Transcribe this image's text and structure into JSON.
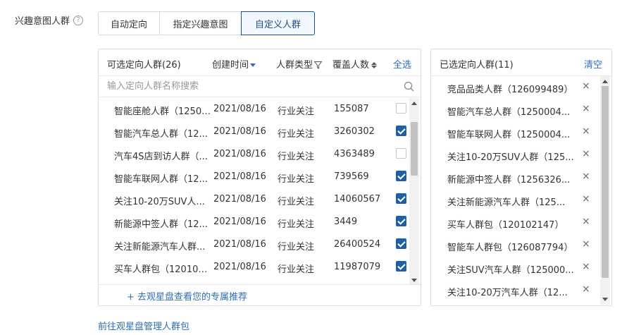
{
  "field": {
    "label": "兴趣意图人群",
    "help_icon": "?"
  },
  "tabs": [
    {
      "label": "自动定向",
      "active": false
    },
    {
      "label": "指定兴趣意图",
      "active": false
    },
    {
      "label": "自定义人群",
      "active": true
    }
  ],
  "left": {
    "title": "可选定向人群(26)",
    "col_created": "创建时间",
    "col_type": "人群类型",
    "col_coverage": "覆盖人数",
    "select_all": "全选",
    "search_placeholder": "输入定向人群名称搜索",
    "rows": [
      {
        "name": "智能座舱人群（12508...",
        "date": "2021/08/16",
        "type": "行业关注",
        "count": "155087",
        "checked": false
      },
      {
        "name": "智能汽车总人群（12...",
        "date": "2021/08/16",
        "type": "行业关注",
        "count": "3260302",
        "checked": true
      },
      {
        "name": "汽车4S店到访人群（...",
        "date": "2021/08/16",
        "type": "行业关注",
        "count": "4363489",
        "checked": false
      },
      {
        "name": "智能车联网人群（12...",
        "date": "2021/08/16",
        "type": "行业关注",
        "count": "739569",
        "checked": true
      },
      {
        "name": "关注10-20万SUV人...",
        "date": "2021/08/16",
        "type": "行业关注",
        "count": "14060567",
        "checked": true
      },
      {
        "name": "新能源中签人群（12...",
        "date": "2021/08/16",
        "type": "行业关注",
        "count": "3449",
        "checked": true
      },
      {
        "name": "关注新能源汽车人群...",
        "date": "2021/08/16",
        "type": "行业关注",
        "count": "26400524",
        "checked": true
      },
      {
        "name": "买车人群包（120102...",
        "date": "2021/08/16",
        "type": "行业关注",
        "count": "11987079",
        "checked": true
      }
    ],
    "footer_link": "+ 去观星盘查看您的专属推荐"
  },
  "right": {
    "title": "已选定向人群(11)",
    "clear": "清空",
    "items": [
      "竞品品类人群（126099489）",
      "智能汽车总人群（1250004...",
      "智能车联网人群（1250004...",
      "关注10-20万SUV人群（125...",
      "新能源中签人群（1256326...",
      "关注新能源汽车人群（125...",
      "买车人群包（120102147）",
      "智能车人群包（126087794）",
      "关注SUV汽车人群（125000...",
      "关注10-20万汽车人群（12..."
    ],
    "remove_glyph": "×"
  },
  "bottom_link": "前往观星盘管理人群包",
  "colors": {
    "accent": "#2f6db5",
    "checkbox": "#1f5fa8"
  }
}
